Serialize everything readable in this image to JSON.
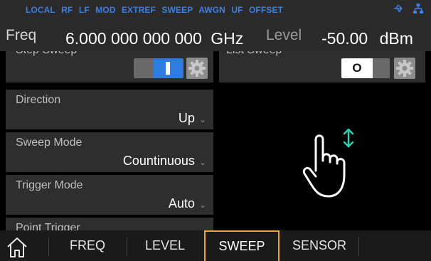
{
  "status_bar": {
    "flags": [
      "LOCAL",
      "RF",
      "LF",
      "MOD",
      "EXTREF",
      "SWEEP",
      "AWGN",
      "UF",
      "OFFSET"
    ],
    "icons": [
      "usb-icon",
      "network-icon"
    ]
  },
  "params": {
    "freq_label": "Freq",
    "freq_value": "6.000 000 000 000",
    "freq_unit": "GHz",
    "level_label": "Level",
    "level_value": "-50.00",
    "level_unit": "dBm"
  },
  "sweep": {
    "step_sweep_label": "Step Sweep",
    "step_sweep_state": "on",
    "list_sweep_label": "List Sweep",
    "list_sweep_state": "O",
    "direction_label": "Direction",
    "direction_value": "Up",
    "mode_label": "Sweep Mode",
    "mode_value": "Countinuous",
    "trigger_label": "Trigger Mode",
    "trigger_value": "Auto",
    "point_trigger_label": "Point Trigger"
  },
  "tabs": [
    {
      "label": "FREQ"
    },
    {
      "label": "LEVEL"
    },
    {
      "label": "SWEEP"
    },
    {
      "label": "SENSOR"
    }
  ],
  "colors": {
    "accent_blue": "#2d7ee0",
    "active_tab_border": "#e7a93a",
    "gesture": "#2fd1b3"
  }
}
